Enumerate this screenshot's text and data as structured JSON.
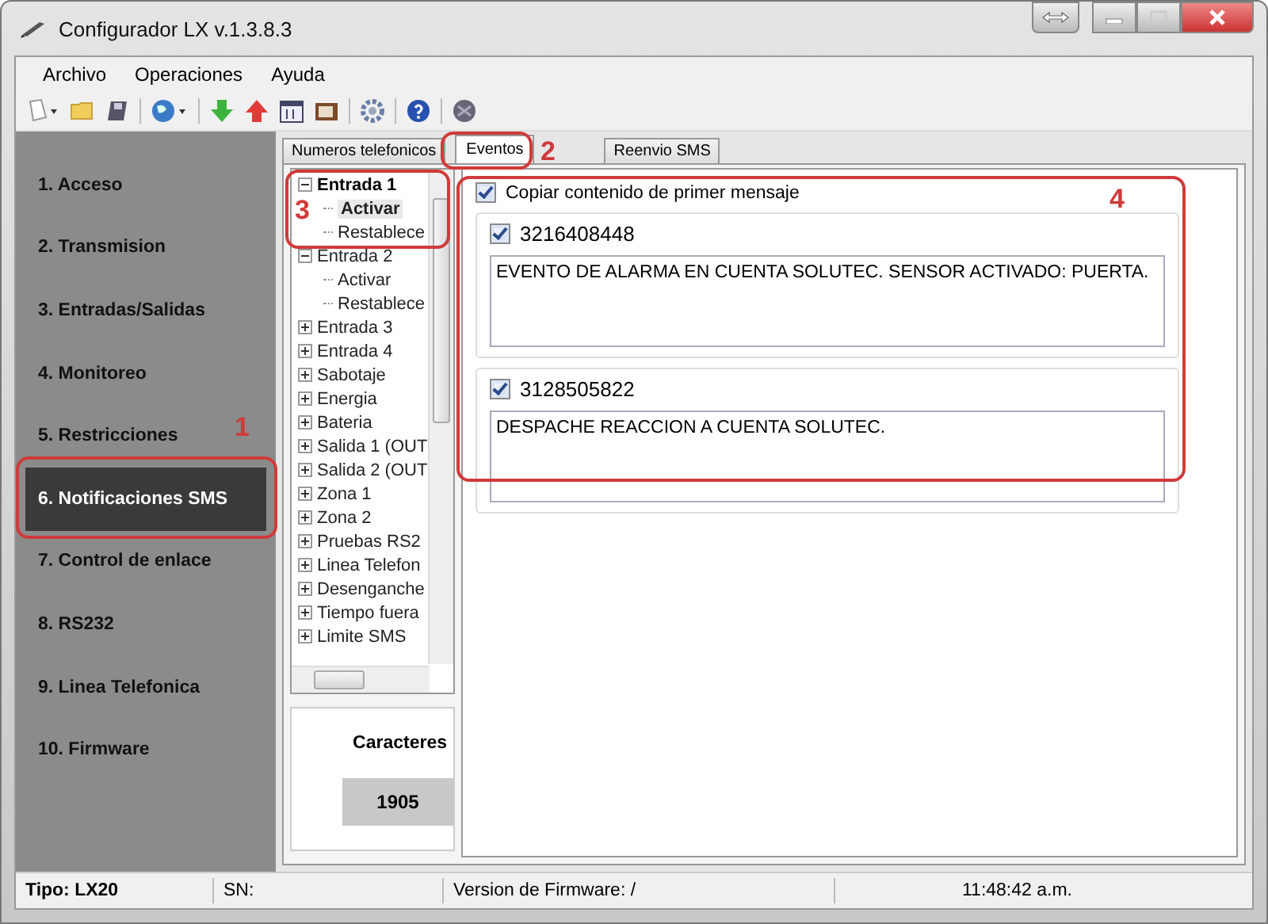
{
  "window": {
    "title": "Configurador LX v.1.3.8.3"
  },
  "menu": [
    "Archivo",
    "Operaciones",
    "Ayuda"
  ],
  "sidebar": {
    "items": [
      {
        "label": "1. Acceso",
        "selected": false
      },
      {
        "label": "2. Transmision",
        "selected": false
      },
      {
        "label": "3. Entradas/Salidas",
        "selected": false
      },
      {
        "label": "4. Monitoreo",
        "selected": false
      },
      {
        "label": "5. Restricciones",
        "selected": false
      },
      {
        "label": "6. Notificaciones SMS",
        "selected": true
      },
      {
        "label": "7. Control de enlace",
        "selected": false
      },
      {
        "label": "8. RS232",
        "selected": false
      },
      {
        "label": "9. Linea Telefonica",
        "selected": false
      },
      {
        "label": "10. Firmware",
        "selected": false
      }
    ]
  },
  "tabs": [
    {
      "label": "Numeros telefonicos",
      "selected": false
    },
    {
      "label": "Eventos",
      "selected": true
    },
    {
      "label": "Reenvio SMS",
      "selected": false
    }
  ],
  "tree": [
    {
      "label": "Entrada 1",
      "expanded": true,
      "children": [
        {
          "label": "Activar",
          "selected": true
        },
        {
          "label": "Restablece",
          "selected": false
        }
      ]
    },
    {
      "label": "Entrada 2",
      "expanded": true,
      "children": [
        {
          "label": "Activar",
          "selected": false
        },
        {
          "label": "Restablece",
          "selected": false
        }
      ]
    },
    {
      "label": "Entrada 3",
      "expanded": false
    },
    {
      "label": "Entrada 4",
      "expanded": false
    },
    {
      "label": "Sabotaje",
      "expanded": false
    },
    {
      "label": "Energia",
      "expanded": false
    },
    {
      "label": "Bateria",
      "expanded": false
    },
    {
      "label": "Salida 1 (OUT",
      "expanded": false
    },
    {
      "label": "Salida 2 (OUT",
      "expanded": false
    },
    {
      "label": "Zona 1",
      "expanded": false
    },
    {
      "label": "Zona 2",
      "expanded": false
    },
    {
      "label": "Pruebas RS2",
      "expanded": false
    },
    {
      "label": "Linea Telefon",
      "expanded": false
    },
    {
      "label": "Desenganche",
      "expanded": false
    },
    {
      "label": "Tiempo fuera",
      "expanded": false
    },
    {
      "label": "Limite SMS",
      "expanded": false
    }
  ],
  "counter": {
    "label": "Caracteres",
    "value": "1905"
  },
  "copy_first": {
    "label": "Copiar contenido de primer mensaje",
    "checked": true
  },
  "messages": [
    {
      "phone": "3216408448",
      "checked": true,
      "text": "EVENTO DE ALARMA EN CUENTA SOLUTEC. SENSOR ACTIVADO: PUERTA."
    },
    {
      "phone": "3128505822",
      "checked": true,
      "text": "DESPACHE REACCION A CUENTA SOLUTEC."
    }
  ],
  "status_bar": [
    {
      "text": "Tipo: LX20",
      "bold": true
    },
    {
      "text": "SN:",
      "bold": false
    },
    {
      "text": "Version de Firmware: /",
      "bold": false
    },
    {
      "text": "11:48:42 a.m.",
      "bold": false
    }
  ],
  "annotations": [
    "1",
    "2",
    "3",
    "4"
  ]
}
